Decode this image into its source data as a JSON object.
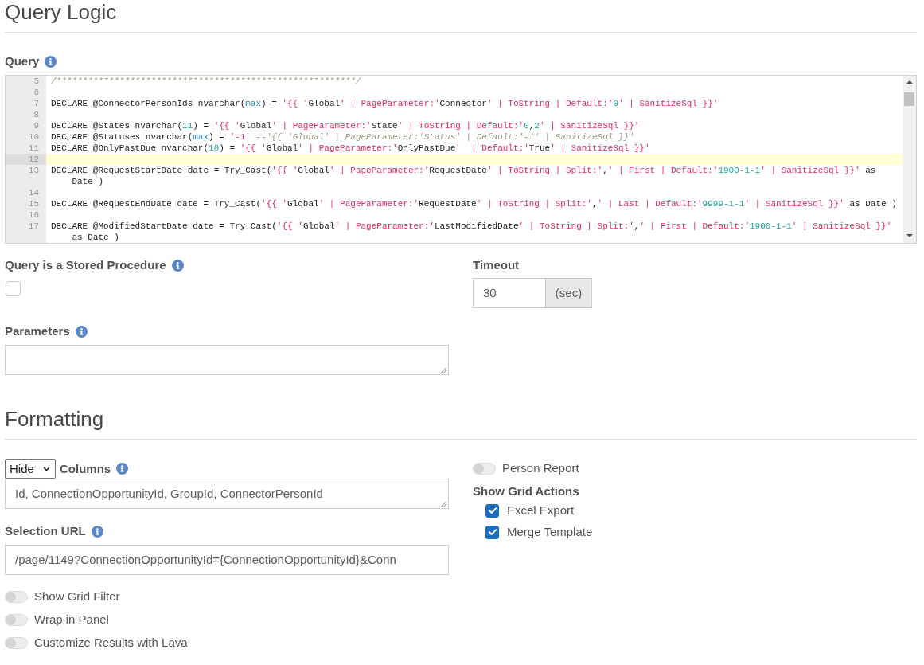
{
  "query_logic": {
    "title": "Query Logic",
    "query": {
      "label": "Query",
      "help": true,
      "editor": {
        "lines": [
          {
            "number": "5",
            "active": false,
            "segments": [
              {
                "kind": "comment",
                "text": "/*********************************************************/"
              }
            ]
          },
          {
            "number": "6",
            "active": false
          },
          {
            "number": "7",
            "active": false,
            "segments": [
              {
                "kind": "plain",
                "text": "DECLARE @ConnectorPersonIds nvarchar("
              },
              {
                "kind": "builtin",
                "text": "max"
              },
              {
                "kind": "plain",
                "text": ") = "
              },
              {
                "kind": "string",
                "text": "'{{ '"
              },
              {
                "kind": "plain",
                "text": "Global"
              },
              {
                "kind": "string",
                "text": "' | PageParameter:'"
              },
              {
                "kind": "plain",
                "text": "Connector"
              },
              {
                "kind": "string",
                "text": "' | ToString | Default:'"
              },
              {
                "kind": "number",
                "text": "0"
              },
              {
                "kind": "string",
                "text": "' | SanitizeSql }}'"
              }
            ]
          },
          {
            "number": "8",
            "active": false
          },
          {
            "number": "9",
            "active": false,
            "segments": [
              {
                "kind": "plain",
                "text": "DECLARE @States nvarchar("
              },
              {
                "kind": "number",
                "text": "11"
              },
              {
                "kind": "plain",
                "text": ") = "
              },
              {
                "kind": "string",
                "text": "'{{ '"
              },
              {
                "kind": "plain",
                "text": "Global"
              },
              {
                "kind": "string",
                "text": "' | PageParameter:'"
              },
              {
                "kind": "plain",
                "text": "State"
              },
              {
                "kind": "string",
                "text": "' | ToString | Default:'"
              },
              {
                "kind": "number",
                "text": "0"
              },
              {
                "kind": "plain",
                "text": ","
              },
              {
                "kind": "number",
                "text": "2"
              },
              {
                "kind": "string",
                "text": "' | SanitizeSql }}'"
              }
            ]
          },
          {
            "number": "10",
            "active": false,
            "segments": [
              {
                "kind": "plain",
                "text": "DECLARE @Statuses nvarchar("
              },
              {
                "kind": "builtin",
                "text": "max"
              },
              {
                "kind": "plain",
                "text": ") = "
              },
              {
                "kind": "string",
                "text": "'-1'"
              },
              {
                "kind": "comment",
                "text": " --'{{ 'Global' | PageParameter:'Status' | Default:'-1' | SanitizeSql }}'"
              }
            ]
          },
          {
            "number": "11",
            "active": false,
            "segments": [
              {
                "kind": "plain",
                "text": "DECLARE @OnlyPastDue nvarchar("
              },
              {
                "kind": "number",
                "text": "10"
              },
              {
                "kind": "plain",
                "text": ") = "
              },
              {
                "kind": "string",
                "text": "'{{ '"
              },
              {
                "kind": "plain",
                "text": "Global"
              },
              {
                "kind": "string",
                "text": "' | PageParameter:'"
              },
              {
                "kind": "plain",
                "text": "OnlyPastDue"
              },
              {
                "kind": "string",
                "text": "'  | Default:'"
              },
              {
                "kind": "plain",
                "text": "True"
              },
              {
                "kind": "string",
                "text": "' | SanitizeSql }}'"
              }
            ]
          },
          {
            "number": "12",
            "active": true
          },
          {
            "number": "13",
            "active": false,
            "segments": [
              {
                "kind": "plain",
                "text": "DECLARE @RequestStartDate date = Try_Cast("
              },
              {
                "kind": "string",
                "text": "'{{ '"
              },
              {
                "kind": "plain",
                "text": "Global"
              },
              {
                "kind": "string",
                "text": "' | PageParameter:'"
              },
              {
                "kind": "plain",
                "text": "RequestDate"
              },
              {
                "kind": "string",
                "text": "' | ToString | Split:'"
              },
              {
                "kind": "plain",
                "text": ","
              },
              {
                "kind": "string",
                "text": "' | First | Default:'"
              },
              {
                "kind": "number",
                "text": "1900-1-1"
              },
              {
                "kind": "string",
                "text": "' | SanitizeSql }}'"
              },
              {
                "kind": "plain",
                "text": " as Date )"
              }
            ]
          },
          {
            "number": "14",
            "active": false
          },
          {
            "number": "15",
            "active": false,
            "segments": [
              {
                "kind": "plain",
                "text": "DECLARE @RequestEndDate date = Try_Cast("
              },
              {
                "kind": "string",
                "text": "'{{ '"
              },
              {
                "kind": "plain",
                "text": "Global"
              },
              {
                "kind": "string",
                "text": "' | PageParameter:'"
              },
              {
                "kind": "plain",
                "text": "RequestDate"
              },
              {
                "kind": "string",
                "text": "' | ToString | Split:'"
              },
              {
                "kind": "plain",
                "text": ","
              },
              {
                "kind": "string",
                "text": "' | Last | Default:'"
              },
              {
                "kind": "number",
                "text": "9999-1-1"
              },
              {
                "kind": "string",
                "text": "' | SanitizeSql }}'"
              },
              {
                "kind": "plain",
                "text": " as Date )"
              }
            ]
          },
          {
            "number": "16",
            "active": false
          },
          {
            "number": "17",
            "active": false,
            "segments": [
              {
                "kind": "plain",
                "text": "DECLARE @ModifiedStartDate date = Try_Cast("
              },
              {
                "kind": "string",
                "text": "'{{ '"
              },
              {
                "kind": "plain",
                "text": "Global"
              },
              {
                "kind": "string",
                "text": "' | PageParameter:'"
              },
              {
                "kind": "plain",
                "text": "LastModifiedDate"
              },
              {
                "kind": "string",
                "text": "' | ToString | Split:'"
              },
              {
                "kind": "plain",
                "text": ","
              },
              {
                "kind": "string",
                "text": "' | First | Default:'"
              },
              {
                "kind": "number",
                "text": "1900-1-1"
              },
              {
                "kind": "string",
                "text": "' | SanitizeSql }}'"
              },
              {
                "kind": "plain",
                "text": " as Date )"
              }
            ]
          }
        ]
      }
    },
    "stored_procedure": {
      "label": "Query is a Stored Procedure",
      "help": true,
      "checked": false
    },
    "timeout": {
      "label": "Timeout",
      "value": "30",
      "unit": "(sec)"
    },
    "parameters": {
      "label": "Parameters",
      "help": true
    }
  },
  "formatting": {
    "title": "Formatting",
    "columns": {
      "dropdown_value": "Hide",
      "label": "Columns",
      "help": true,
      "value": "Id, ConnectionOpportunityId, GroupId, ConnectorPersonId"
    },
    "selection_url": {
      "label": "Selection URL",
      "help": true,
      "value": "/page/1149?ConnectionOpportunityId={ConnectionOpportunityId}&Conn"
    },
    "toggles": [
      {
        "label": "Show Grid Filter",
        "on": false
      },
      {
        "label": "Wrap in Panel",
        "on": false
      },
      {
        "label": "Customize Results with Lava",
        "on": false
      }
    ],
    "person_report": {
      "label": "Person Report",
      "on": false
    },
    "grid_actions": {
      "label": "Show Grid Actions",
      "options": [
        {
          "label": "Excel Export",
          "checked": true
        },
        {
          "label": "Merge Template",
          "checked": true
        }
      ]
    }
  }
}
